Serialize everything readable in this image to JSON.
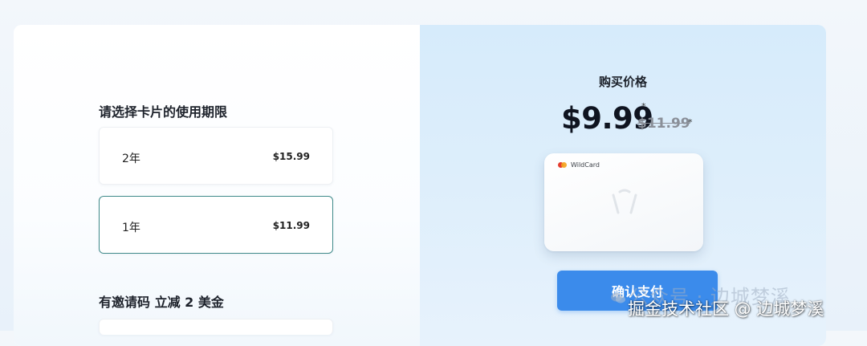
{
  "left": {
    "validity_title": "请选择卡片的使用期限",
    "options": [
      {
        "label": "2年",
        "price": "$15.99",
        "selected": false
      },
      {
        "label": "1年",
        "price": "$11.99",
        "selected": true
      }
    ],
    "invite_title": "有邀请码 立减 2 美金"
  },
  "right": {
    "price_label": "购买价格",
    "current_price": "$9.99",
    "asterisk": "*",
    "original_price": "$11.99",
    "card_brand": "WildCard",
    "confirm_label": "确认支付"
  },
  "watermarks": {
    "faint": "公众号 · 边城梦溪",
    "main": "掘金技术社区 @ 边城梦溪"
  },
  "colors": {
    "accent_blue": "#3b8beb",
    "selected_border": "#3f8a8a",
    "right_panel_bg": "#d6ebfb"
  }
}
